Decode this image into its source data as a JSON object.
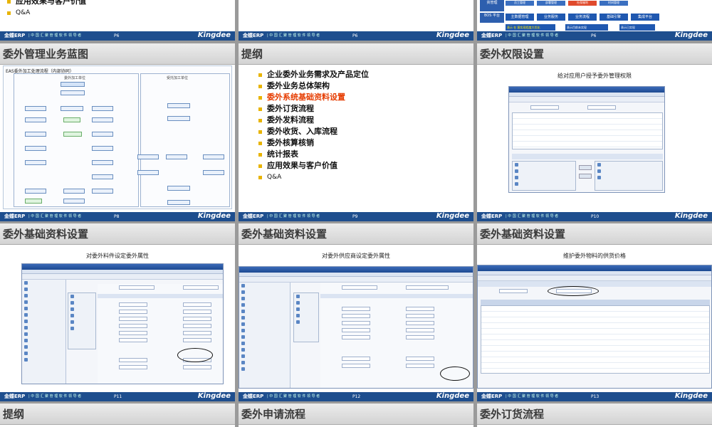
{
  "footer": {
    "erp": "金蝶ERP",
    "slogan": "| 中 国 汇 聚 管 理 软 件 领 导 者",
    "brand": "Kingdee"
  },
  "slides": {
    "s1": {
      "items": [
        "应用效果与客户价值",
        "Q&A"
      ]
    },
    "s2": {
      "page": "P6"
    },
    "s3": {
      "page": "P6",
      "labels": [
        "资管理",
        "BOS 平台",
        "主数据管理",
        "业务服务",
        "业务流程",
        "基础引擎",
        "集成平台",
        "员工管理",
        "部署管理",
        "社保福利",
        "时间管理"
      ],
      "legend": [
        "表示 在 客实现程度大优化",
        "表示目前未实现",
        "表示已实现"
      ]
    },
    "s4": {
      "title": "委外管理业务蓝图",
      "diagram_title": "EAS委外加工处理流程（内部协同）",
      "lane_left": "委外加工单位",
      "lane_right": "受托加工单位",
      "page": "P8"
    },
    "s5": {
      "title": "提纲",
      "items": [
        "企业委外业务需求及产品定位",
        "委外业务总体架构",
        "委外系统基础资料设置",
        "委外订货流程",
        "委外发料流程",
        "委外收货、入库流程",
        "委外核算核销",
        "统计报表",
        "应用效果与客户价值",
        "Q&A"
      ],
      "highlight_index": 2,
      "page": "P9"
    },
    "s6": {
      "title": "委外权限设置",
      "caption": "给对应用户授予委外管理权限",
      "page": "P10"
    },
    "s7": {
      "title": "委外基础资料设置",
      "caption": "对委外料件设定委外属性",
      "page": "P11"
    },
    "s8": {
      "title": "委外基础资料设置",
      "caption": "对委外供应商设定委外属性",
      "page": "P12"
    },
    "s9": {
      "title": "委外基础资料设置",
      "caption": "维护委外物料的供货价格",
      "page": "P13"
    },
    "s10": {
      "title": "提纲"
    },
    "s11": {
      "title": "委外申请流程"
    },
    "s12": {
      "title": "委外订货流程"
    }
  }
}
